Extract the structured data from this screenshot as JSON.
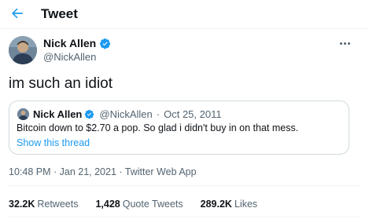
{
  "header": {
    "title": "Tweet",
    "back_icon": "arrow-left-icon"
  },
  "colors": {
    "accent": "#1d9bf0",
    "text": "#0f1419",
    "secondary": "#536471",
    "border": "#cfd9de"
  },
  "tweet": {
    "author": {
      "name": "Nick Allen",
      "handle": "@NickAllen",
      "verified": true
    },
    "text": "im such an idiot",
    "timestamp": "10:48 PM · Jan 21, 2021 · Twitter Web App",
    "more_icon": "more-horizontal-icon"
  },
  "quoted_tweet": {
    "author": {
      "name": "Nick Allen",
      "handle": "@NickAllen",
      "verified": true
    },
    "separator": "·",
    "date": "Oct 25, 2011",
    "text": "Bitcoin down to $2.70 a pop. So glad i didn't buy in on that mess.",
    "show_thread": "Show this thread"
  },
  "stats": {
    "retweets": {
      "count": "32.2K",
      "label": "Retweets"
    },
    "quote_tweets": {
      "count": "1,428",
      "label": "Quote Tweets"
    },
    "likes": {
      "count": "289.2K",
      "label": "Likes"
    }
  }
}
